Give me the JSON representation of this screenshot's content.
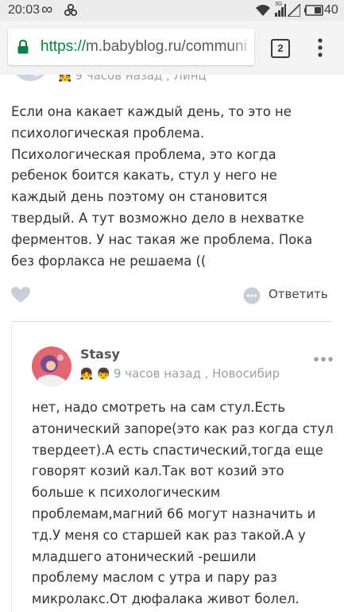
{
  "status_bar": {
    "time": "20:03",
    "network_label": "3G",
    "battery_level": "40"
  },
  "browser": {
    "url_scheme": "https://",
    "url_rest": "m.babyblog.ru/communi",
    "tab_count": "2"
  },
  "previous_comment": {
    "meta": "9 часов назад , Линц",
    "text_lines": [
      "Если она какает каждый день, то это не",
      "психологическая проблема.",
      "Психологическая проблема, это когда",
      "ребенок боится какать, стул у него не",
      "каждый день поэтому он становится",
      "твердый. А тут возможно дело в нехватке",
      "ферментов. У нас такая же проблема. Пока",
      "без форлакса не решаема (("
    ],
    "reply_label": "Ответить"
  },
  "reply_comment": {
    "username": "Stasy",
    "meta": "9 часов назад , Новосибир",
    "text_lines": [
      "нет, надо смотреть на сам стул.Есть",
      "атонический запоре(это как раз когда стул",
      "твердеет).А есть спастический,тогда еще",
      "говорят козий кал.Так вот козий это",
      "больше к психологическим",
      "проблемам,магний 66 могут назначить и",
      "тд.У меня со старшей как раз такой.А у",
      "младшего атонический -решили",
      "проблему маслом с утра и пару раз",
      "микролакс.От дюфалака живот болел."
    ]
  },
  "colors": {
    "link_green": "#0b8043",
    "meta_gray": "#9aa0a6",
    "text": "#333333",
    "icon_gray": "#c7ced6"
  }
}
